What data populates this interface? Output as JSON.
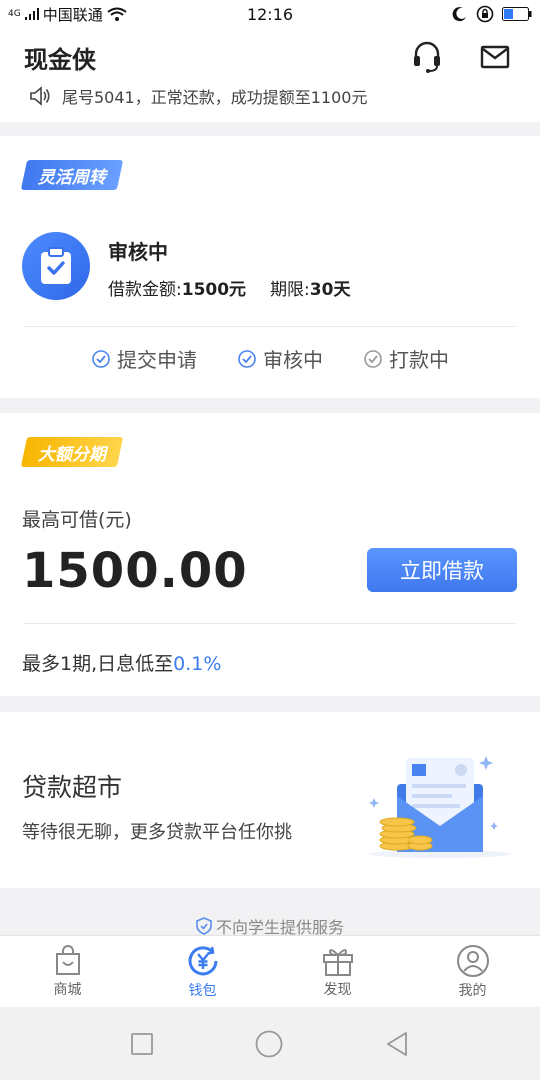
{
  "status_bar": {
    "signal_text": "4G",
    "carrier": "中国联通",
    "time": "12:16"
  },
  "header": {
    "app_title": "现金侠",
    "notice_text": "尾号5041，正常还款，成功提额至1100元"
  },
  "flexible_card": {
    "tag": "灵活周转",
    "status_title": "审核中",
    "amount_label": "借款金额:",
    "amount_value": "1500元",
    "term_label": "期限:",
    "term_value": "30天",
    "steps": [
      "提交申请",
      "审核中",
      "打款中"
    ]
  },
  "installment_card": {
    "tag": "大额分期",
    "max_label": "最高可借(元)",
    "max_amount": "1500.00",
    "borrow_button": "立即借款",
    "note_prefix": "最多1期,日息低至",
    "note_rate": "0.1%"
  },
  "market_card": {
    "title": "贷款超市",
    "subtitle": "等待很无聊，更多贷款平台任你挑"
  },
  "footer_note": "不向学生提供服务",
  "tabbar": {
    "items": [
      {
        "label": "商城",
        "icon": "shopping-bag-icon"
      },
      {
        "label": "钱包",
        "icon": "wallet-yen-icon"
      },
      {
        "label": "发现",
        "icon": "gift-icon"
      },
      {
        "label": "我的",
        "icon": "profile-icon"
      }
    ],
    "active_index": 1
  },
  "colors": {
    "accent_blue": "#3b7cf0",
    "tag_yellow": "#f7b500"
  }
}
